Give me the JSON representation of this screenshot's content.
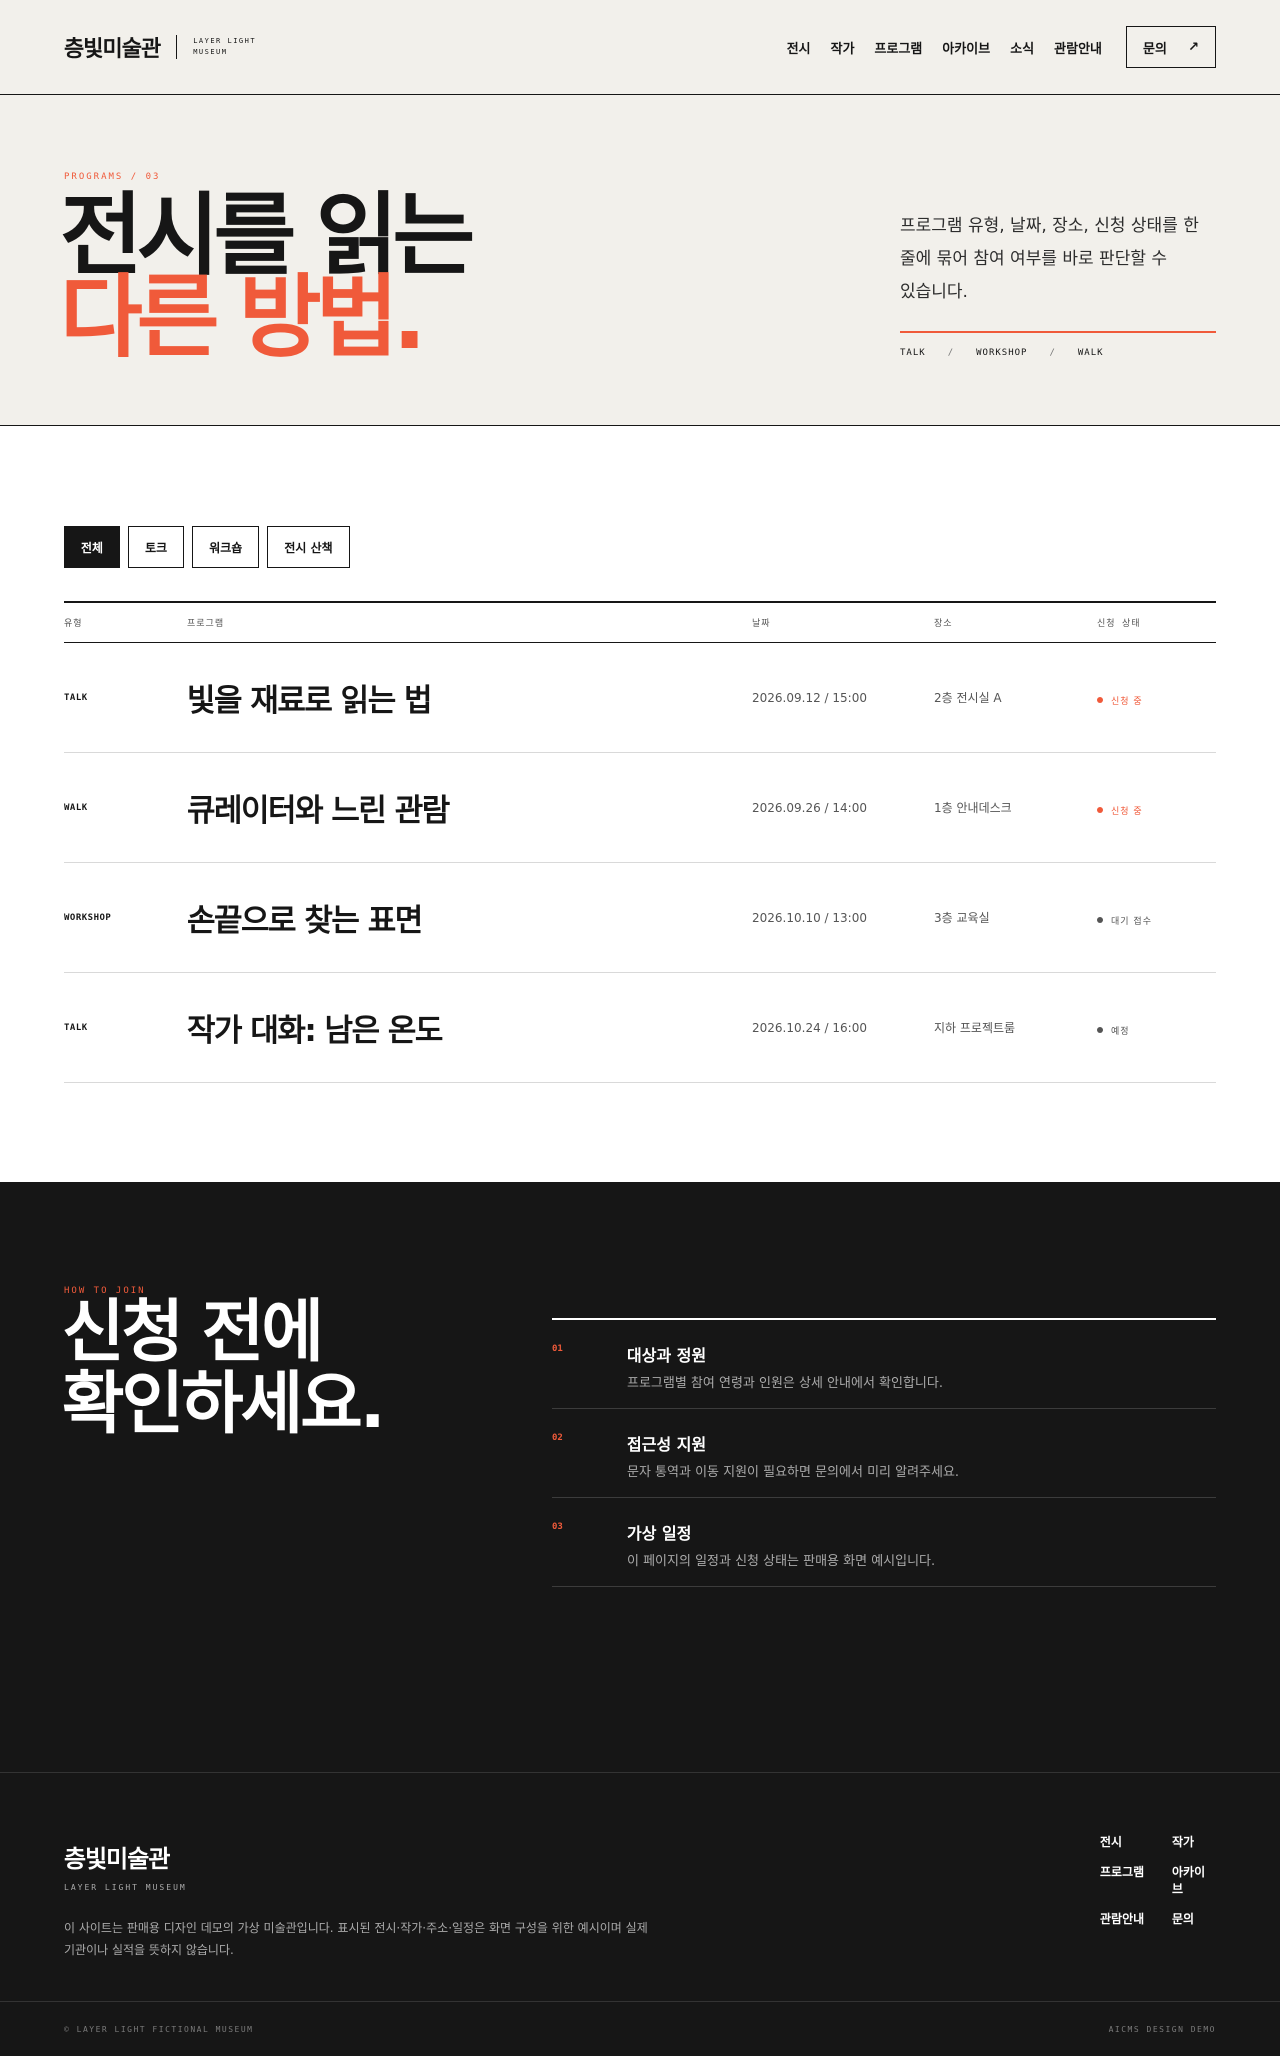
{
  "colors": {
    "accent": "#f05a3a",
    "ink": "#161616",
    "cream": "#f2f0eb",
    "muted_status": "#555555"
  },
  "header": {
    "brand_name": "층빛미술관",
    "brand_sub": "LAYER LIGHT MUSEUM",
    "nav": [
      "전시",
      "작가",
      "프로그램",
      "아카이브",
      "소식",
      "관람안내"
    ],
    "cta_label": "문의",
    "cta_icon": "arrow-up-right-icon",
    "cta_arrow": "↗"
  },
  "hero": {
    "eyebrow": "PROGRAMS / 03",
    "title_line1": "전시를 읽는",
    "title_line2": "다른 방법.",
    "description": "프로그램 유형, 날짜, 장소, 신청 상태를 한 줄에 묶어 참여 여부를 바로 판단할 수 있습니다.",
    "tags": [
      "TALK",
      "WORKSHOP",
      "WALK"
    ],
    "tag_separator": "/"
  },
  "filters": {
    "items": [
      "전체",
      "토크",
      "워크숍",
      "전시 산책"
    ],
    "selected": "전체"
  },
  "table": {
    "headers": {
      "type": "유형",
      "title": "프로그램",
      "date": "날짜",
      "place": "장소",
      "status": "신청 상태"
    },
    "rows": [
      {
        "type": "TALK",
        "title": "빛을 재료로 읽는 법",
        "date": "2026.09.12 / 15:00",
        "place": "2층 전시실 A",
        "status": "신청 중",
        "status_color": "#f05a3a"
      },
      {
        "type": "WALK",
        "title": "큐레이터와 느린 관람",
        "date": "2026.09.26 / 14:00",
        "place": "1층 안내데스크",
        "status": "신청 중",
        "status_color": "#f05a3a"
      },
      {
        "type": "WORKSHOP",
        "title": "손끝으로 찾는 표면",
        "date": "2026.10.10 / 13:00",
        "place": "3층 교육실",
        "status": "대기 접수",
        "status_color": "#555555"
      },
      {
        "type": "TALK",
        "title": "작가 대화: 남은 온도",
        "date": "2026.10.24 / 16:00",
        "place": "지하 프로젝트룸",
        "status": "예정",
        "status_color": "#555555"
      }
    ]
  },
  "join": {
    "eyebrow": "HOW TO JOIN",
    "title_line1": "신청 전에",
    "title_line2": "확인하세요.",
    "items": [
      {
        "num": "01",
        "title": "대상과 정원",
        "desc": "프로그램별 참여 연령과 인원은 상세 안내에서 확인합니다."
      },
      {
        "num": "02",
        "title": "접근성 지원",
        "desc": "문자 통역과 이동 지원이 필요하면 문의에서 미리 알려주세요."
      },
      {
        "num": "03",
        "title": "가상 일정",
        "desc": "이 페이지의 일정과 신청 상태는 판매용 화면 예시입니다."
      }
    ]
  },
  "footer": {
    "brand_name": "층빛미술관",
    "brand_sub": "LAYER LIGHT MUSEUM",
    "note": "이 사이트는 판매용 디자인 데모의 가상 미술관입니다. 표시된 전시·작가·주소·일정은 화면 구성을 위한 예시이며 실제 기관이나 실적을 뜻하지 않습니다.",
    "nav": [
      "전시",
      "작가",
      "프로그램",
      "아카이브",
      "관람안내",
      "문의"
    ],
    "copyright": "© LAYER LIGHT FICTIONAL MUSEUM",
    "credit": "AICMS DESIGN DEMO"
  }
}
